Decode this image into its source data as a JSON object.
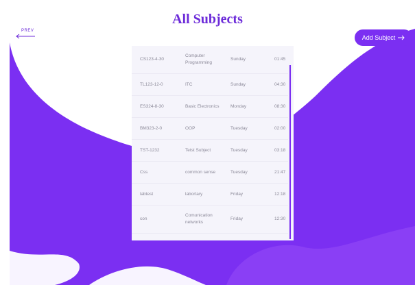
{
  "header": {
    "title": "All Subjects",
    "prev_label": "PREV",
    "add_button_label": "Add Subject"
  },
  "colors": {
    "accent": "#7b2ff2",
    "title": "#6c2bd9",
    "background": "#ffffff",
    "table_bg": "#f5f4fb"
  },
  "icons": {
    "prev": "arrow-left-icon",
    "add": "arrow-right-icon"
  },
  "subjects": [
    {
      "code": "CS123-4-30",
      "name": "Computer Programming",
      "day": "Sunday",
      "time": "01:45"
    },
    {
      "code": "TL123-12-0",
      "name": "ITC",
      "day": "Sunday",
      "time": "04:30"
    },
    {
      "code": "ES324-8-30",
      "name": "Basic Electronics",
      "day": "Monday",
      "time": "08:30"
    },
    {
      "code": "BM323-2-0",
      "name": "OOP",
      "day": "Tuesday",
      "time": "02:00"
    },
    {
      "code": "TST-1232",
      "name": "Tetst Subject",
      "day": "Tuesday",
      "time": "03:18"
    },
    {
      "code": "Css",
      "name": "common sense",
      "day": "Tuesday",
      "time": "21:47"
    },
    {
      "code": "labtest",
      "name": "labortary",
      "day": "Friday",
      "time": "12:18"
    },
    {
      "code": "con",
      "name": "Comunication networks",
      "day": "Friday",
      "time": "12:30"
    }
  ]
}
